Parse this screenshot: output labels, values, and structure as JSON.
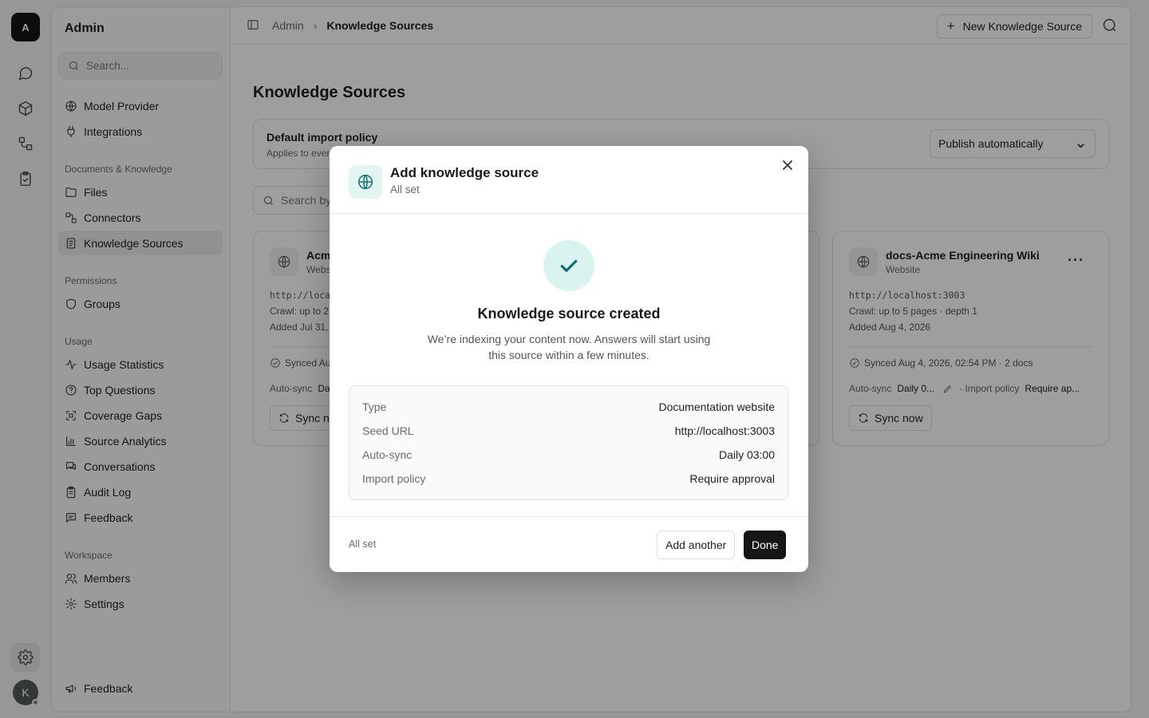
{
  "rail": {
    "logo_letter": "A",
    "avatar_letter": "K"
  },
  "sidebar": {
    "title": "Admin",
    "search_placeholder": "Search...",
    "top_items": [
      {
        "label": "Model Provider",
        "icon": "globe-icon"
      },
      {
        "label": "Integrations",
        "icon": "plug-icon"
      }
    ],
    "sections": [
      {
        "label": "Documents & Knowledge",
        "items": [
          {
            "label": "Files",
            "icon": "folder-icon"
          },
          {
            "label": "Connectors",
            "icon": "connectors-icon"
          },
          {
            "label": "Knowledge Sources",
            "icon": "book-icon",
            "active": true
          }
        ]
      },
      {
        "label": "Permissions",
        "items": [
          {
            "label": "Groups",
            "icon": "shield-icon"
          }
        ]
      },
      {
        "label": "Usage",
        "items": [
          {
            "label": "Usage Statistics",
            "icon": "activity-icon"
          },
          {
            "label": "Top Questions",
            "icon": "question-icon"
          },
          {
            "label": "Coverage Gaps",
            "icon": "scan-icon"
          },
          {
            "label": "Source Analytics",
            "icon": "bar-chart-icon"
          },
          {
            "label": "Conversations",
            "icon": "chat-icon"
          },
          {
            "label": "Audit Log",
            "icon": "clipboard-icon"
          },
          {
            "label": "Feedback",
            "icon": "message-icon"
          }
        ]
      },
      {
        "label": "Workspace",
        "items": [
          {
            "label": "Members",
            "icon": "users-icon"
          },
          {
            "label": "Settings",
            "icon": "gear-icon"
          }
        ]
      }
    ],
    "bottom_item": {
      "label": "Feedback",
      "icon": "megaphone-icon"
    }
  },
  "header": {
    "breadcrumb_root": "Admin",
    "breadcrumb_current": "Knowledge Sources",
    "new_button": "New Knowledge Source"
  },
  "page": {
    "title": "Knowledge Sources",
    "policy": {
      "title": "Default import policy",
      "subtitle": "Applies to ever",
      "selected": "Publish automatically"
    },
    "search_placeholder": "Search by"
  },
  "cards": [
    {
      "name": "Acm",
      "kind": "Webs",
      "url": "http://loca",
      "crawl": "Crawl: up to 2",
      "added": "Added Jul 31,",
      "synced": "Synced Au",
      "autosync_label": "Auto-sync",
      "autosync_value": "Da",
      "sync_button": "Sync no"
    },
    {
      "name": "docs-Acme Engineering Wiki",
      "kind": "Website",
      "url": "http://localhost:3003",
      "crawl": "Crawl: up to 5 pages · depth 1",
      "added": "Added Aug 4, 2026",
      "synced": "Synced Aug 4, 2026, 02:54 PM · 2 docs",
      "autosync_label": "Auto-sync",
      "autosync_value": "Daily 0...",
      "import_label": "· Import policy",
      "import_value": "Require ap...",
      "sync_button": "Sync now"
    }
  ],
  "modal": {
    "title": "Add knowledge source",
    "subtitle": "All set",
    "heading": "Knowledge source created",
    "description": "We’re indexing your content now. Answers will start using this source within a few minutes.",
    "summary": [
      {
        "key": "Type",
        "value": "Documentation website"
      },
      {
        "key": "Seed URL",
        "value": "http://localhost:3003"
      },
      {
        "key": "Auto-sync",
        "value": "Daily 03:00"
      },
      {
        "key": "Import policy",
        "value": "Require approval"
      }
    ],
    "footer_status": "All set",
    "add_another": "Add another",
    "done": "Done"
  },
  "colors": {
    "accent_teal": "#0f6f79",
    "success_bg": "#d9f4ee",
    "primary_button": "#161616"
  }
}
